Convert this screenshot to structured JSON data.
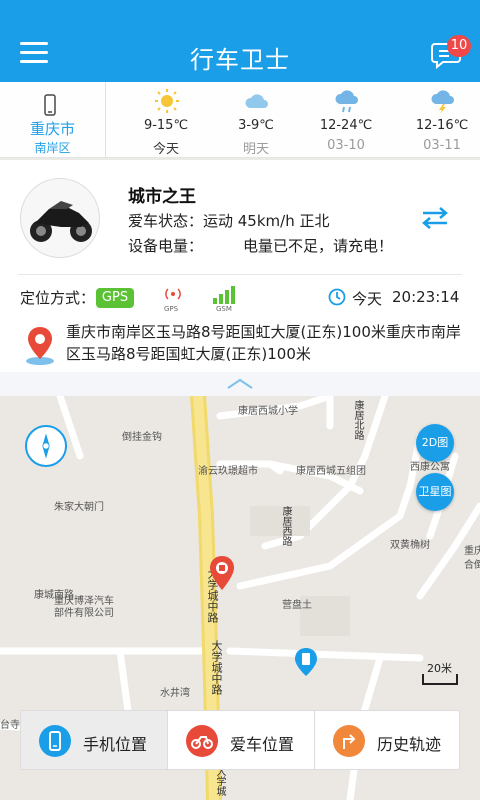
{
  "header": {
    "title": "行车卫士",
    "message_badge": "10"
  },
  "weather": {
    "city": "重庆市",
    "district": "南岸区",
    "days": [
      {
        "temp": "9-15℃",
        "label": "今天",
        "icon": "sunny-icon"
      },
      {
        "temp": "3-9℃",
        "label": "明天",
        "icon": "cloudy-icon"
      },
      {
        "temp": "12-24℃",
        "label": "03-10",
        "icon": "light-rain-icon"
      },
      {
        "temp": "12-16℃",
        "label": "03-11",
        "icon": "thunder-rain-icon"
      }
    ]
  },
  "vehicle": {
    "name": "城市之王",
    "status": "爱车状态：运动  45km/h  正北",
    "battery_label": "设备电量：",
    "battery_warning": "电量已不足，请充电！"
  },
  "location": {
    "mode_label": "定位方式：",
    "mode_value": "GPS",
    "gps_caption": "GPS",
    "gsm_caption": "GSM",
    "date_label": "今天",
    "time": "20:23:14",
    "address": "重庆市南岸区玉马路8号距国虹大厦(正东)100米重庆市南岸区玉马路8号距国虹大厦(正东)100米"
  },
  "map": {
    "labels": {
      "school": "康居西城小学",
      "market": "渝云玖璟超市",
      "group5": "康居西城五组团",
      "xirong": "西康公寓",
      "jingou": "倒挂金钩",
      "zhujia": "朱家大朝门",
      "kangcheng": "康城南路",
      "bosen": "重庆博泽汽车",
      "bosen2": "部件有限公司",
      "shuangjing": "双黄桷树",
      "yingpan": "营盘土",
      "shuijing": "水井湾",
      "chongqing_edge": "重庆",
      "he": "合倒",
      "tai": "台寺",
      "road1": "大学城中路",
      "road2": "大学城中路",
      "road3": "康居西路",
      "road4": "康居北路",
      "road5": "大学城"
    },
    "btn_2d": "2D图",
    "btn_sat": "卫星图",
    "scale": "20米",
    "primary_color": "#1b9ee8",
    "pin_color": "#e84a3a"
  },
  "tabs": [
    {
      "label": "手机位置",
      "icon": "phone-location-icon",
      "color": "#1b9ee8"
    },
    {
      "label": "爱车位置",
      "icon": "motorcycle-location-icon",
      "color": "#e84a3a"
    },
    {
      "label": "历史轨迹",
      "icon": "history-track-icon",
      "color": "#f0873a"
    }
  ]
}
